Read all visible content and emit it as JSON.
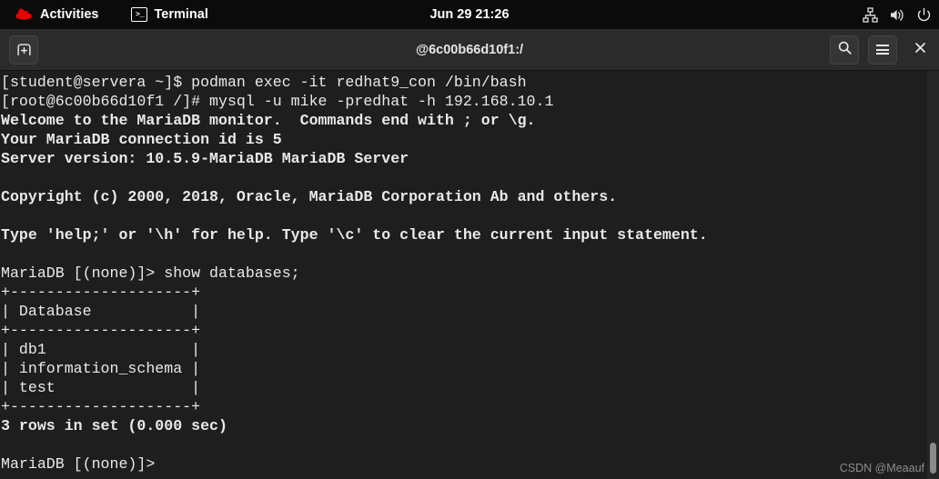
{
  "topbar": {
    "activities_label": "Activities",
    "app_label": "Terminal",
    "app_icon": "terminal-icon",
    "logo_icon": "redhat-logo-icon",
    "clock": "Jun 29  21:26",
    "tray": [
      {
        "name": "network-wired-icon"
      },
      {
        "name": "volume-icon"
      },
      {
        "name": "power-icon"
      }
    ]
  },
  "window": {
    "title": "@6c00b66d10f1:/",
    "new_tab_icon": "new-tab-icon",
    "search_icon": "search-icon",
    "menu_icon": "hamburger-menu-icon",
    "close_icon": "close-icon"
  },
  "terminal": {
    "lines": [
      {
        "text": "[student@servera ~]$ podman exec -it redhat9_con /bin/bash",
        "bold": false
      },
      {
        "text": "[root@6c00b66d10f1 /]# mysql -u mike -predhat -h 192.168.10.1",
        "bold": false
      },
      {
        "text": "Welcome to the MariaDB monitor.  Commands end with ; or \\g.",
        "bold": true
      },
      {
        "text": "Your MariaDB connection id is 5",
        "bold": true
      },
      {
        "text": "Server version: 10.5.9-MariaDB MariaDB Server",
        "bold": true
      },
      {
        "text": "",
        "bold": false
      },
      {
        "text": "Copyright (c) 2000, 2018, Oracle, MariaDB Corporation Ab and others.",
        "bold": true
      },
      {
        "text": "",
        "bold": false
      },
      {
        "text": "Type 'help;' or '\\h' for help. Type '\\c' to clear the current input statement.",
        "bold": true
      },
      {
        "text": "",
        "bold": false
      },
      {
        "text": "MariaDB [(none)]> show databases;",
        "bold": false
      },
      {
        "text": "+--------------------+",
        "bold": false
      },
      {
        "text": "| Database           |",
        "bold": false
      },
      {
        "text": "+--------------------+",
        "bold": false
      },
      {
        "text": "| db1                |",
        "bold": false
      },
      {
        "text": "| information_schema |",
        "bold": false
      },
      {
        "text": "| test               |",
        "bold": false
      },
      {
        "text": "+--------------------+",
        "bold": false
      },
      {
        "text": "3 rows in set (0.000 sec)",
        "bold": true
      },
      {
        "text": "",
        "bold": false
      },
      {
        "text": "MariaDB [(none)]>",
        "bold": false
      }
    ],
    "watermark": "CSDN @Meaauf"
  }
}
